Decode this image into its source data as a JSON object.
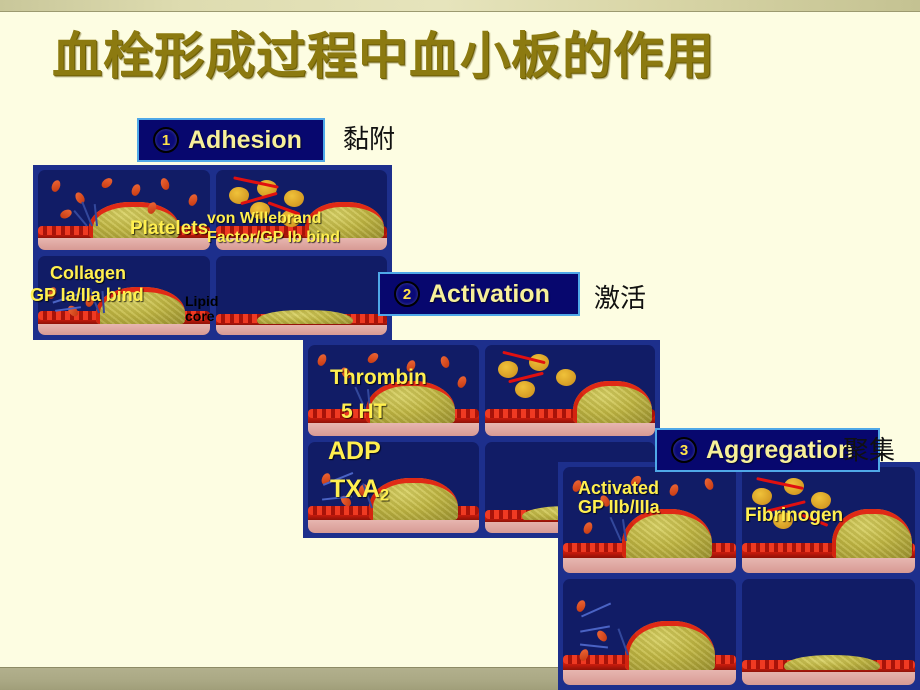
{
  "slide": {
    "title": "血栓形成过程中血小板的作用",
    "title_color": "#8c7a10",
    "background_color": "#fdfde2",
    "accent_bar_color": "#b2b08d"
  },
  "stages": [
    {
      "number": "1",
      "label": "Adhesion",
      "translation": "黏附",
      "header_bg": "#07076e",
      "header_border": "#4fa8e8",
      "label_color": "#f7f09a",
      "panel_labels": [
        {
          "text": "Platelets",
          "color": "yellow"
        },
        {
          "text": "von Willebrand",
          "color": "yellow"
        },
        {
          "text": "Factor/GP Ib bind",
          "color": "yellow"
        },
        {
          "text": "Collagen",
          "color": "yellow"
        },
        {
          "text": "GP Ia/IIa bind",
          "color": "yellow"
        },
        {
          "text": "Lipid",
          "color": "black"
        },
        {
          "text": "core",
          "color": "black"
        }
      ]
    },
    {
      "number": "2",
      "label": "Activation",
      "translation": "激活",
      "header_bg": "#07076e",
      "header_border": "#4fa8e8",
      "label_color": "#f7f09a",
      "panel_labels": [
        {
          "text": "Thrombin",
          "color": "yellow"
        },
        {
          "text": "5 HT",
          "color": "yellow"
        },
        {
          "text": "ADP",
          "color": "yellow"
        },
        {
          "text": "TXA",
          "subscript": "2",
          "color": "yellow"
        }
      ]
    },
    {
      "number": "3",
      "label": "Aggregation",
      "translation": "聚集",
      "header_bg": "#07076e",
      "header_border": "#4fa8e8",
      "label_color": "#f7f09a",
      "panel_labels": [
        {
          "text": "Activated",
          "color": "yellow"
        },
        {
          "text": "GP IIb/IIIa",
          "color": "yellow"
        },
        {
          "text": "Fibrinogen",
          "color": "yellow"
        }
      ]
    }
  ],
  "labels": {
    "platelets": "Platelets",
    "vwf_line1": "von Willebrand",
    "vwf_line2": "Factor/GP Ib bind",
    "collagen_line1": "Collagen",
    "collagen_line2": "GP Ia/IIa bind",
    "lipid_line1": "Lipid",
    "lipid_line2": "core",
    "thrombin": "Thrombin",
    "ht5": "5 HT",
    "adp": "ADP",
    "txa2_base": "TXA",
    "txa2_sub": "2",
    "activated_line1": "Activated",
    "activated_line2": "GP IIb/IIIa",
    "fibrinogen": "Fibrinogen"
  }
}
